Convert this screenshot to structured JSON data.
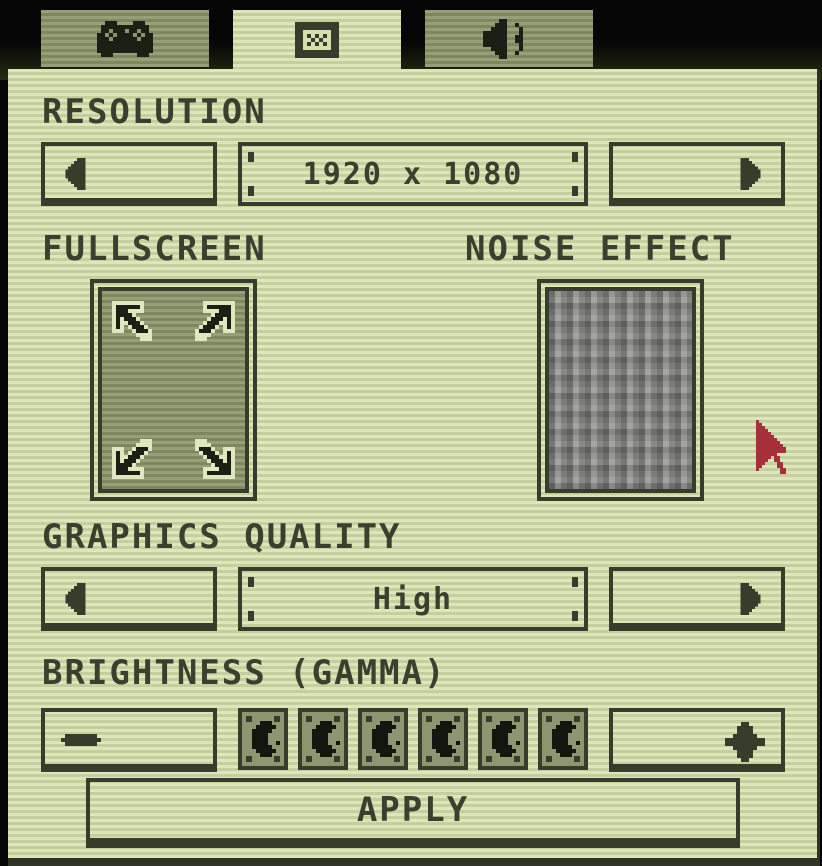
{
  "tabs": [
    {
      "id": "controls",
      "icon": "gamepad-icon",
      "active": false
    },
    {
      "id": "display",
      "icon": "display-icon",
      "active": true
    },
    {
      "id": "audio",
      "icon": "speaker-icon",
      "active": false
    }
  ],
  "resolution": {
    "label": "RESOLUTION",
    "value": "1920 x 1080",
    "prev_icon": "arrow-left-icon",
    "next_icon": "arrow-right-icon"
  },
  "fullscreen": {
    "label": "FULLSCREEN",
    "icon": "expand-arrows-icon",
    "enabled": true
  },
  "noise_effect": {
    "label": "NOISE EFFECT",
    "enabled": true
  },
  "graphics_quality": {
    "label": "GRAPHICS QUALITY",
    "value": "High",
    "prev_icon": "arrow-left-icon",
    "next_icon": "arrow-right-icon"
  },
  "brightness": {
    "label": "BRIGHTNESS (GAMMA)",
    "decrease_icon": "minus-icon",
    "increase_icon": "plus-icon",
    "level": 6,
    "max": 6,
    "segment_icon": "moon-icon"
  },
  "apply": {
    "label": "APPLY"
  },
  "colors": {
    "panel": "#d6dfae",
    "ink": "#373d2c",
    "inactive_tab": "#8a946a",
    "cursor": "#a3303a"
  }
}
